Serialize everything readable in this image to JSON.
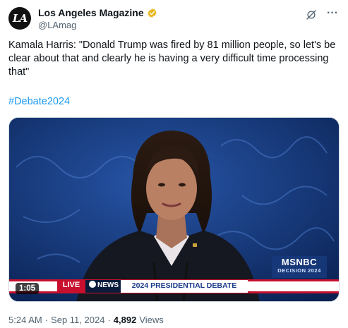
{
  "author": {
    "name": "Los Angeles Magazine",
    "handle": "@LAmag",
    "avatar_text": "LA",
    "verified_color": "#e8b923"
  },
  "tweet": {
    "text": "Kamala Harris: \"Donald Trump was fired by 81 million people, so let's be clear about that and clearly he is having a very difficult time processing that\"",
    "hashtag": "#Debate2024"
  },
  "video": {
    "duration": "1:05",
    "lower_third": {
      "live": "LIVE",
      "network": "NEWS",
      "title": "2024 PRESIDENTIAL DEBATE"
    },
    "bug": {
      "network": "MSNBC",
      "program": "DECISION 2024"
    },
    "icons": [
      "peacock-icon",
      "abc-logo-icon"
    ]
  },
  "meta": {
    "time": "5:24 AM",
    "date": "Sep 11, 2024",
    "separator": "·",
    "views_count": "4,892",
    "views_label": "Views"
  },
  "colors": {
    "link": "#1d9bf0",
    "secondary_text": "#536471",
    "backdrop": "#0d2a62"
  }
}
